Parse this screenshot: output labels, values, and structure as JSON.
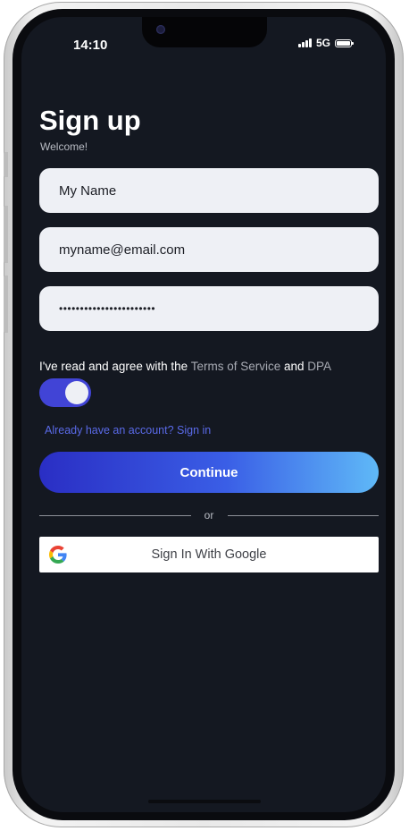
{
  "status_bar": {
    "time": "14:10",
    "network": "5G"
  },
  "header": {
    "title": "Sign up",
    "subtitle": "Welcome!"
  },
  "form": {
    "name_value": "My Name",
    "email_value": "myname@email.com",
    "password_value": "•••••••••••••••••••••••"
  },
  "agreement": {
    "prefix": "I've read and agree with the ",
    "terms_link": "Terms of Service",
    "conjunction": " and ",
    "dpa_link": "DPA",
    "toggle_on": true
  },
  "links": {
    "signin": "Already have an account? Sign in"
  },
  "buttons": {
    "continue_label": "Continue",
    "divider_text": "or",
    "google_label": "Sign In With Google"
  },
  "icons": {
    "google": "google-logo-icon",
    "signal": "signal-bars-icon",
    "battery": "battery-icon",
    "camera": "front-camera-icon"
  },
  "colors": {
    "background": "#141821",
    "accent": "#4144d6",
    "link": "#5a6ae8",
    "field_bg": "#eef0f5"
  }
}
